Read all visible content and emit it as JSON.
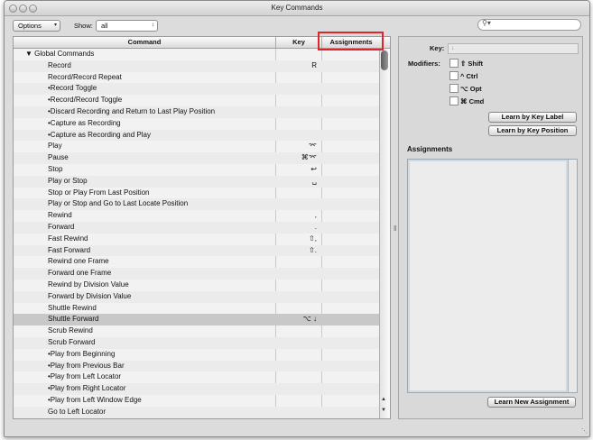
{
  "window": {
    "title": "Key Commands"
  },
  "toolbar": {
    "options_label": "Options",
    "show_label": "Show:",
    "show_value": "all",
    "search_placeholder": ""
  },
  "table": {
    "columns": [
      "Command",
      "Key",
      "Assignments"
    ],
    "rows": [
      {
        "command": "▼ Global Commands",
        "key": "",
        "indent": 0
      },
      {
        "command": "Record",
        "key": "R",
        "indent": 1
      },
      {
        "command": "Record/Record Repeat",
        "key": "",
        "indent": 1
      },
      {
        "command": "•Record Toggle",
        "key": "",
        "indent": 1
      },
      {
        "command": "•Record/Record Toggle",
        "key": "",
        "indent": 1
      },
      {
        "command": "•Discard Recording and Return to Last Play Position",
        "key": "",
        "indent": 1
      },
      {
        "command": "•Capture as Recording",
        "key": "",
        "indent": 1
      },
      {
        "command": "•Capture as Recording and Play",
        "key": "",
        "indent": 1
      },
      {
        "command": "Play",
        "key": "⌤",
        "indent": 1
      },
      {
        "command": "Pause",
        "key": "⌘⌤",
        "indent": 1
      },
      {
        "command": "Stop",
        "key": "↩",
        "indent": 1
      },
      {
        "command": "Play or Stop",
        "key": "␣",
        "indent": 1
      },
      {
        "command": "Stop or Play From Last Position",
        "key": "",
        "indent": 1
      },
      {
        "command": "Play or Stop and Go to Last Locate Position",
        "key": "",
        "indent": 1
      },
      {
        "command": "Rewind",
        "key": ",",
        "indent": 1
      },
      {
        "command": "Forward",
        "key": ".",
        "indent": 1
      },
      {
        "command": "Fast Rewind",
        "key": "⇧,",
        "indent": 1
      },
      {
        "command": "Fast Forward",
        "key": "⇧.",
        "indent": 1
      },
      {
        "command": "Rewind one Frame",
        "key": "",
        "indent": 1
      },
      {
        "command": "Forward one Frame",
        "key": "",
        "indent": 1
      },
      {
        "command": "Rewind by Division Value",
        "key": "",
        "indent": 1
      },
      {
        "command": "Forward by Division Value",
        "key": "",
        "indent": 1
      },
      {
        "command": "Shuttle Rewind",
        "key": "",
        "indent": 1
      },
      {
        "command": "Shuttle Forward",
        "key": "⌥ ↓",
        "indent": 1
      },
      {
        "command": "Scrub Rewind",
        "key": "",
        "indent": 1
      },
      {
        "command": "Scrub Forward",
        "key": "",
        "indent": 1
      },
      {
        "command": "•Play from Beginning",
        "key": "",
        "indent": 1
      },
      {
        "command": "•Play from Previous Bar",
        "key": "",
        "indent": 1
      },
      {
        "command": "•Play from Left Locator",
        "key": "",
        "indent": 1
      },
      {
        "command": "•Play from Right Locator",
        "key": "",
        "indent": 1
      },
      {
        "command": "•Play from Left Window Edge",
        "key": "",
        "indent": 1
      },
      {
        "command": "Go to Left Locator",
        "key": "",
        "indent": 1
      }
    ],
    "selected_row": 23
  },
  "right": {
    "key_label": "Key:",
    "key_value": "↓",
    "modifiers_label": "Modifiers:",
    "modifiers": [
      {
        "symbol": "⇧",
        "name": "Shift"
      },
      {
        "symbol": "^",
        "name": "Ctrl"
      },
      {
        "symbol": "⌥",
        "name": "Opt"
      },
      {
        "symbol": "⌘",
        "name": "Cmd"
      }
    ],
    "learn_label_btn": "Learn by Key Label",
    "learn_position_btn": "Learn by Key Position",
    "assignments_header": "Assignments",
    "learn_new_btn": "Learn New Assignment"
  }
}
